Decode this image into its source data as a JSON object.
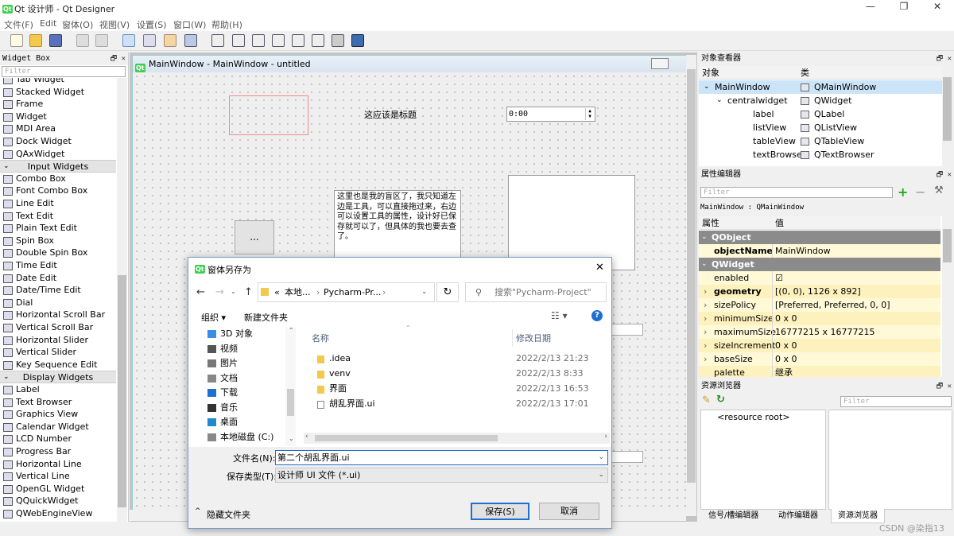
{
  "app": {
    "title": "Qt 设计师 - Qt Designer",
    "badge": "Qt",
    "window_controls": [
      "—",
      "❐",
      "✕"
    ]
  },
  "menu": [
    "文件(F)",
    "Edit",
    "窗体(O)",
    "视图(V)",
    "设置(S)",
    "窗口(W)",
    "帮助(H)"
  ],
  "widget_box": {
    "title": "Widget Box",
    "controls": "🗗 ✕",
    "filter_placeholder": "Filter",
    "items": [
      {
        "label": "Tab Widget"
      },
      {
        "label": "Stacked Widget"
      },
      {
        "label": "Frame"
      },
      {
        "label": "Widget"
      },
      {
        "label": "MDI Area"
      },
      {
        "label": "Dock Widget"
      },
      {
        "label": "QAxWidget"
      },
      {
        "label": "Input Widgets",
        "category": true
      },
      {
        "label": "Combo Box"
      },
      {
        "label": "Font Combo Box"
      },
      {
        "label": "Line Edit"
      },
      {
        "label": "Text Edit"
      },
      {
        "label": "Plain Text Edit"
      },
      {
        "label": "Spin Box"
      },
      {
        "label": "Double Spin Box"
      },
      {
        "label": "Time Edit"
      },
      {
        "label": "Date Edit"
      },
      {
        "label": "Date/Time Edit"
      },
      {
        "label": "Dial"
      },
      {
        "label": "Horizontal Scroll Bar"
      },
      {
        "label": "Vertical Scroll Bar"
      },
      {
        "label": "Horizontal Slider"
      },
      {
        "label": "Vertical Slider"
      },
      {
        "label": "Key Sequence Edit"
      },
      {
        "label": "Display Widgets",
        "category": true
      },
      {
        "label": "Label"
      },
      {
        "label": "Text Browser"
      },
      {
        "label": "Graphics View"
      },
      {
        "label": "Calendar Widget"
      },
      {
        "label": "LCD Number"
      },
      {
        "label": "Progress Bar"
      },
      {
        "label": "Horizontal Line"
      },
      {
        "label": "Vertical Line"
      },
      {
        "label": "OpenGL Widget"
      },
      {
        "label": "QQuickWidget"
      },
      {
        "label": "QWebEngineView"
      }
    ]
  },
  "form": {
    "title": "MainWindow - MainWindow - untitled",
    "label_text": "这应该是标题",
    "time_value": "0:00",
    "button_text": "...",
    "text_edit_content": "这里也是我的盲区了，我只知道左边是工具，可以直接拖过来，右边可以设置工具的属性，设计好已保存就可以了，但具体的我也要去查了。"
  },
  "object_inspector": {
    "title": "对象查看器",
    "col_object": "对象",
    "col_class": "类",
    "rows": [
      {
        "name": "MainWindow",
        "class": "QMainWindow",
        "selected": true
      },
      {
        "name": "centralwidget",
        "class": "QWidget"
      },
      {
        "name": "label",
        "class": "QLabel"
      },
      {
        "name": "listView",
        "class": "QListView"
      },
      {
        "name": "tableView",
        "class": "QTableView"
      },
      {
        "name": "textBrowser",
        "class": "QTextBrowser"
      }
    ]
  },
  "property_editor": {
    "title": "属性编辑器",
    "filter_placeholder": "Filter",
    "object_line": "MainWindow : QMainWindow",
    "col_prop": "属性",
    "col_value": "值",
    "rows": [
      {
        "group": true,
        "name": "QObject"
      },
      {
        "name": "objectName",
        "value": "MainWindow",
        "bold": true
      },
      {
        "group": true,
        "name": "QWidget"
      },
      {
        "name": "enabled",
        "value": "☑"
      },
      {
        "name": "geometry",
        "value": "[(0, 0), 1126 x 892]",
        "bold": true,
        "expand": true
      },
      {
        "name": "sizePolicy",
        "value": "[Preferred, Preferred, 0, 0]",
        "expand": true
      },
      {
        "name": "minimumSize",
        "value": "0 x 0",
        "expand": true
      },
      {
        "name": "maximumSize",
        "value": "16777215 x 16777215",
        "expand": true
      },
      {
        "name": "sizeIncrement",
        "value": "0 x 0",
        "expand": true
      },
      {
        "name": "baseSize",
        "value": "0 x 0",
        "expand": true
      },
      {
        "name": "palette",
        "value": "继承"
      }
    ]
  },
  "resource_browser": {
    "title": "资源浏览器",
    "filter_placeholder": "Filter",
    "root": "<resource root>"
  },
  "bottom_tabs": [
    "信号/槽编辑器",
    "动作编辑器",
    "资源浏览器"
  ],
  "watermark": "CSDN @染指13",
  "dialog": {
    "title": "窗体另存为",
    "breadcrumb": [
      "«",
      "本地...",
      "Pycharm-Pr..."
    ],
    "search_placeholder": "搜索\"Pycharm-Project\"",
    "organize": "组织 ▾",
    "new_folder": "新建文件夹",
    "col_name": "名称",
    "col_date": "修改日期",
    "nav": [
      "3D 对象",
      "视频",
      "图片",
      "文档",
      "下载",
      "音乐",
      "桌面",
      "本地磁盘 (C:)"
    ],
    "files": [
      {
        "name": ".idea",
        "date": "2022/2/13 21:23",
        "type": "folder"
      },
      {
        "name": "venv",
        "date": "2022/2/13 8:33",
        "type": "folder"
      },
      {
        "name": "界面",
        "date": "2022/2/13 16:53",
        "type": "folder"
      },
      {
        "name": "胡乱界面.ui",
        "date": "2022/2/13 17:01",
        "type": "file"
      }
    ],
    "filename_label": "文件名(N):",
    "filename_value": "第二个胡乱界面.ui",
    "filetype_label": "保存类型(T):",
    "filetype_value": "设计师 UI 文件 (*.ui)",
    "hide_folders": "隐藏文件夹",
    "save": "保存(S)",
    "cancel": "取消"
  }
}
